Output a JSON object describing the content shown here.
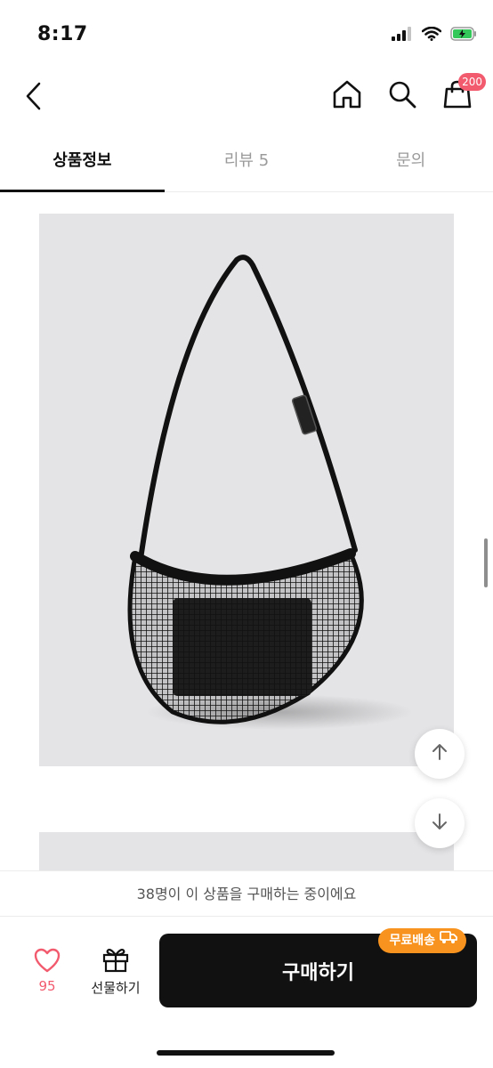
{
  "status_bar": {
    "time": "8:17",
    "icons": [
      "signal-icon",
      "wifi-icon",
      "battery-charging-icon"
    ]
  },
  "nav": {
    "back_icon": "chevron-left-icon",
    "home_icon": "home-icon",
    "search_icon": "search-icon",
    "cart_icon": "shopping-bag-icon",
    "cart_badge": "200"
  },
  "tabs": [
    {
      "label": "상품정보",
      "active": true
    },
    {
      "label": "리뷰 5",
      "active": false
    },
    {
      "label": "문의",
      "active": false
    }
  ],
  "floating": {
    "up_icon": "arrow-up-icon",
    "down_icon": "arrow-down-icon"
  },
  "info_strip": {
    "text": "38명이 이 상품을 구매하는 중이에요"
  },
  "bottom_bar": {
    "like_icon": "heart-icon",
    "like_count": "95",
    "gift_icon": "gift-icon",
    "gift_label": "선물하기",
    "buy_label": "구매하기",
    "free_shipping_label": "무료배송",
    "free_shipping_icon": "truck-icon"
  },
  "colors": {
    "accent_pink": "#f25a6e",
    "badge_orange": "#f7931e",
    "button_dark": "#111111",
    "image_bg": "#e4e4e6"
  }
}
